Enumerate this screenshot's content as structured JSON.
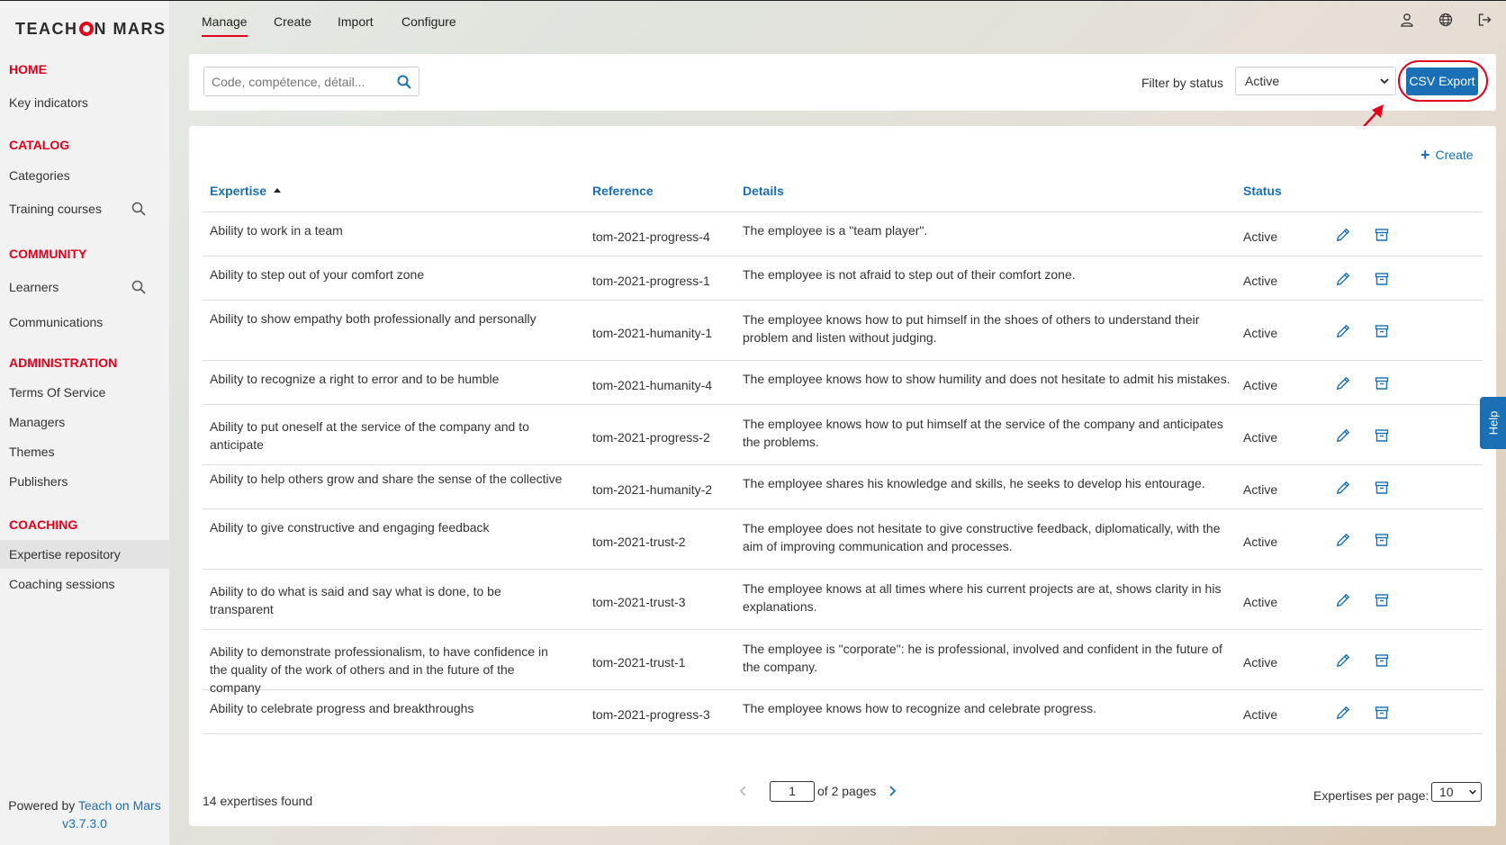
{
  "brand": {
    "logo_left": "TEACH",
    "logo_right": "N MARS"
  },
  "sidebar": {
    "sections": [
      {
        "title": "HOME",
        "items": [
          "Key indicators"
        ]
      },
      {
        "title": "CATALOG",
        "items": [
          "Categories",
          "Training courses"
        ]
      },
      {
        "title": "COMMUNITY",
        "items": [
          "Learners",
          "Communications"
        ]
      },
      {
        "title": "ADMINISTRATION",
        "items": [
          "Terms Of Service",
          "Managers",
          "Themes",
          "Publishers"
        ]
      },
      {
        "title": "COACHING",
        "items": [
          "Expertise repository",
          "Coaching sessions"
        ]
      }
    ],
    "active_item": "Expertise repository",
    "powered_prefix": "Powered by",
    "powered_link": "Teach on Mars",
    "version": "v3.7.3.0"
  },
  "topnav": {
    "tabs": [
      "Manage",
      "Create",
      "Import",
      "Configure"
    ],
    "active": "Manage"
  },
  "top_icons": [
    "user-icon",
    "globe-icon",
    "logout-icon"
  ],
  "filter": {
    "search_placeholder": "Code, compétence, détail...",
    "status_label": "Filter by status",
    "status_value": "Active",
    "export_label": "CSV Export"
  },
  "create_label": "Create",
  "table": {
    "headers": {
      "expertise": "Expertise",
      "reference": "Reference",
      "details": "Details",
      "status": "Status"
    },
    "rows": [
      {
        "expertise": "Ability to work in a team",
        "reference": "tom-2021-progress-4",
        "details": "The employee is a \"team player\".",
        "status": "Active"
      },
      {
        "expertise": "Ability to step out of your comfort zone",
        "reference": "tom-2021-progress-1",
        "details": "The employee is not afraid to step out of their comfort zone.",
        "status": "Active"
      },
      {
        "expertise": "Ability to show empathy both professionally and personally",
        "reference": "tom-2021-humanity-1",
        "details": "The employee knows how to put himself in the shoes of others to understand their problem and listen without judging.",
        "status": "Active"
      },
      {
        "expertise": "Ability to recognize a right to error and to be humble",
        "reference": "tom-2021-humanity-4",
        "details": "The employee knows how to show humility and does not hesitate to admit his mistakes.",
        "status": "Active"
      },
      {
        "expertise": "Ability to put oneself at the service of the company and to anticipate",
        "reference": "tom-2021-progress-2",
        "details": "The employee knows how to put himself at the service of the company and anticipates the problems.",
        "status": "Active"
      },
      {
        "expertise": "Ability to help others grow and share the sense of the collective",
        "reference": "tom-2021-humanity-2",
        "details": "The employee shares his knowledge and skills, he seeks to develop his entourage.",
        "status": "Active"
      },
      {
        "expertise": "Ability to give constructive and engaging feedback",
        "reference": "tom-2021-trust-2",
        "details": "The employee does not hesitate to give constructive feedback, diplomatically, with the aim of improving communication and processes.",
        "status": "Active"
      },
      {
        "expertise": "Ability to do what is said and say what is done, to be transparent",
        "reference": "tom-2021-trust-3",
        "details": "The employee knows at all times where his current projects are at, shows clarity in his explanations.",
        "status": "Active"
      },
      {
        "expertise": "Ability to demonstrate professionalism, to have confidence in the quality of the work of others and in the future of the company",
        "reference": "tom-2021-trust-1",
        "details": "The employee is \"corporate\": he is professional, involved and confident in the future of the company.",
        "status": "Active"
      },
      {
        "expertise": "Ability to celebrate progress and breakthroughs",
        "reference": "tom-2021-progress-3",
        "details": "The employee knows how to recognize and celebrate progress.",
        "status": "Active"
      }
    ]
  },
  "footer": {
    "found": "14 expertises found",
    "page_value": "1",
    "page_of": "of 2 pages",
    "per_page_label": "Expertises per page:",
    "per_page_value": "10"
  },
  "help_label": "Help",
  "colors": {
    "brand_red": "#e3001b",
    "link_blue": "#1a6fb5"
  }
}
